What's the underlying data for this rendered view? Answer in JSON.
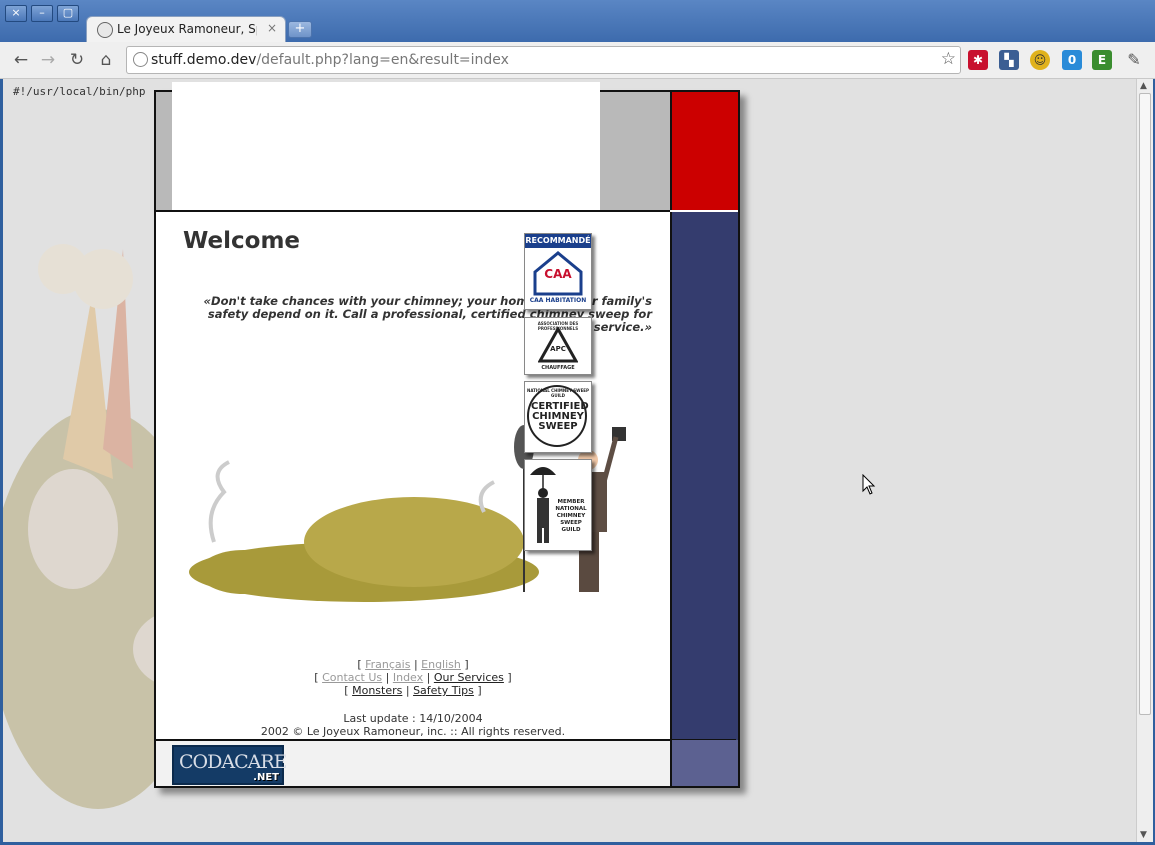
{
  "browser": {
    "tab_title": "Le Joyeux Ramoneur, Spéc",
    "tab_close": "×",
    "new_tab": "+",
    "url_domain": "stuff.demo.dev",
    "url_path": "/default.php?lang=en&result=index",
    "window_buttons": [
      "×",
      "–",
      "▢"
    ],
    "nav_icons": [
      "back-arrow-icon",
      "forward-arrow-icon",
      "reload-icon",
      "home-icon"
    ],
    "extensions": [
      {
        "icon": "lastpass-icon",
        "color": "#c8102e",
        "glyph": "✱"
      },
      {
        "icon": "delicious-icon",
        "color": "#3274d1",
        "glyph": "▚"
      },
      {
        "icon": "smiley-icon",
        "color": "#d9a400",
        "glyph": "☺"
      },
      {
        "icon": "ghost-icon",
        "color": "#2a8bd8",
        "glyph": "0"
      },
      {
        "icon": "evernote-icon",
        "color": "#3a8d2f",
        "glyph": "E"
      },
      {
        "icon": "wrench-icon",
        "color": "#555555",
        "glyph": "🔧"
      }
    ]
  },
  "page": {
    "shebang": "#!/usr/local/bin/php",
    "welcome": "Welcome",
    "quote": "«Don't take chances with your chimney; your home and your family's safety depend on it. Call a professional, certified chimney sweep for complete service.»",
    "nav": {
      "row1": {
        "francais": "Français",
        "english": "English"
      },
      "row2": {
        "contact": "Contact Us",
        "index": "Index",
        "services": "Our Services"
      },
      "row3": {
        "monsters": "Monsters",
        "safety": "Safety Tips"
      }
    },
    "last_update": "Last update : 14/10/2004",
    "copyright": "2002 © Le Joyeux Ramoneur, inc. :: All rights reserved.",
    "codacare": {
      "text": "CODACARE",
      "suffix": ".NET"
    },
    "badges": {
      "caa_top": "RECOMMANDÉ",
      "caa_logo": "CAA",
      "caa_sub": "CAA HABITATION",
      "apc_top": "ASSOCIATION DES PROFESSIONNELS",
      "apc_logo": "APC",
      "apc_sub": "CHAUFFAGE",
      "csia_top": "NATIONAL CHIMNEY SWEEP GUILD",
      "csia_main": "CERTIFIED CHIMNEY SWEEP",
      "ncsg_text": "MEMBER NATIONAL CHIMNEY SWEEP GUILD"
    }
  }
}
